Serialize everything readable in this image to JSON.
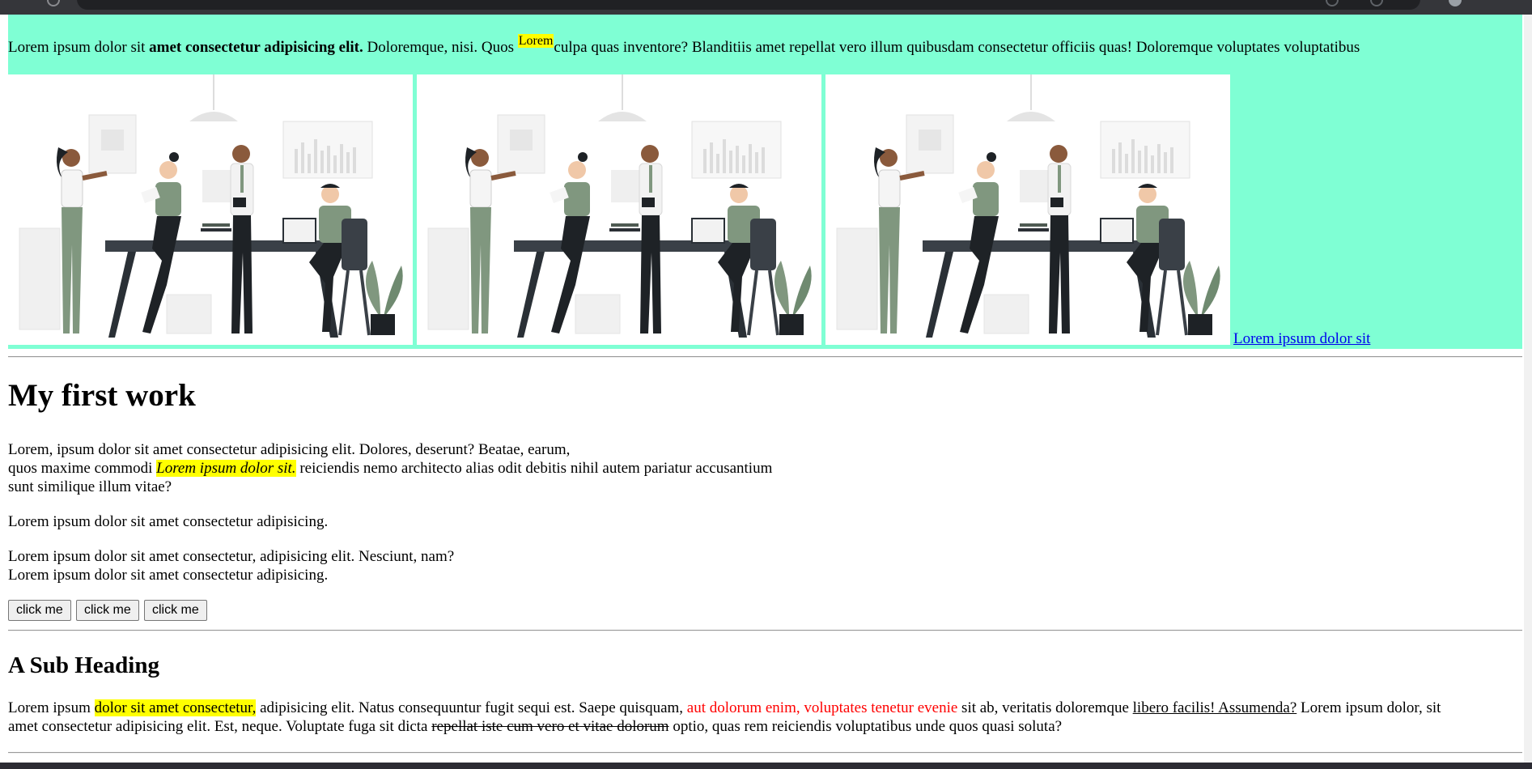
{
  "hero": {
    "text_start": "Lorem ipsum dolor sit ",
    "text_bold": "amet consectetur adipisicing elit.",
    "text_mid": " Doloremque, nisi. Quos ",
    "mark": "Lorem",
    "text_end": "culpa quas inventore? Blanditiis amet repellat vero illum quibusdam consectetur officiis quas! Doloremque voluptates voluptatibus",
    "link": "Lorem ipsum dolor sit",
    "background": "#7fffd4"
  },
  "main": {
    "title": "My first work",
    "p1_line1": "Lorem, ipsum dolor sit amet consectetur adipisicing elit. Dolores, deserunt? Beatae, earum,",
    "p1_line2_start": "quos maxime commodi ",
    "p1_line2_hl": "Lorem ipsum dolor sit.",
    "p1_line2_end": " reiciendis nemo architecto alias odit debitis nihil autem pariatur accusantium",
    "p1_line3": "sunt similique illum vitae?",
    "p2": "Lorem ipsum dolor sit amet consectetur adipisicing.",
    "p3_line1": "Lorem ipsum dolor sit amet consectetur, adipisicing elit. Nesciunt, nam?",
    "p3_line2": "Lorem ipsum dolor sit amet consectetur adipisicing.",
    "buttons": [
      "click me",
      "click me",
      "click me"
    ]
  },
  "sub": {
    "heading": "A Sub Heading",
    "l1_a": "Lorem ipsum ",
    "l1_hl": "dolor sit amet consectetur,",
    "l1_b": " adipisicing elit. Natus consequuntur fugit sequi est. Saepe quisquam, ",
    "l1_red": "aut dolorum enim, voluptates tenetur evenie",
    "l1_c": " sit ab, veritatis doloremque ",
    "l1_u": "libero facilis! Assumenda?",
    "l1_d": " Lorem ipsum dolor, sit",
    "l2_a": "amet consectetur adipisicing elit. Est, neque. Voluptate fuga sit dicta ",
    "l2_s": "repellat iste cum vero et vitae dolorum",
    "l2_b": " optio, quas rem reiciendis voluptatibus unde quos quasi soluta?"
  },
  "colors": {
    "highlight": "#ffff00",
    "red_text": "#ff0000",
    "link": "#0000ee"
  }
}
